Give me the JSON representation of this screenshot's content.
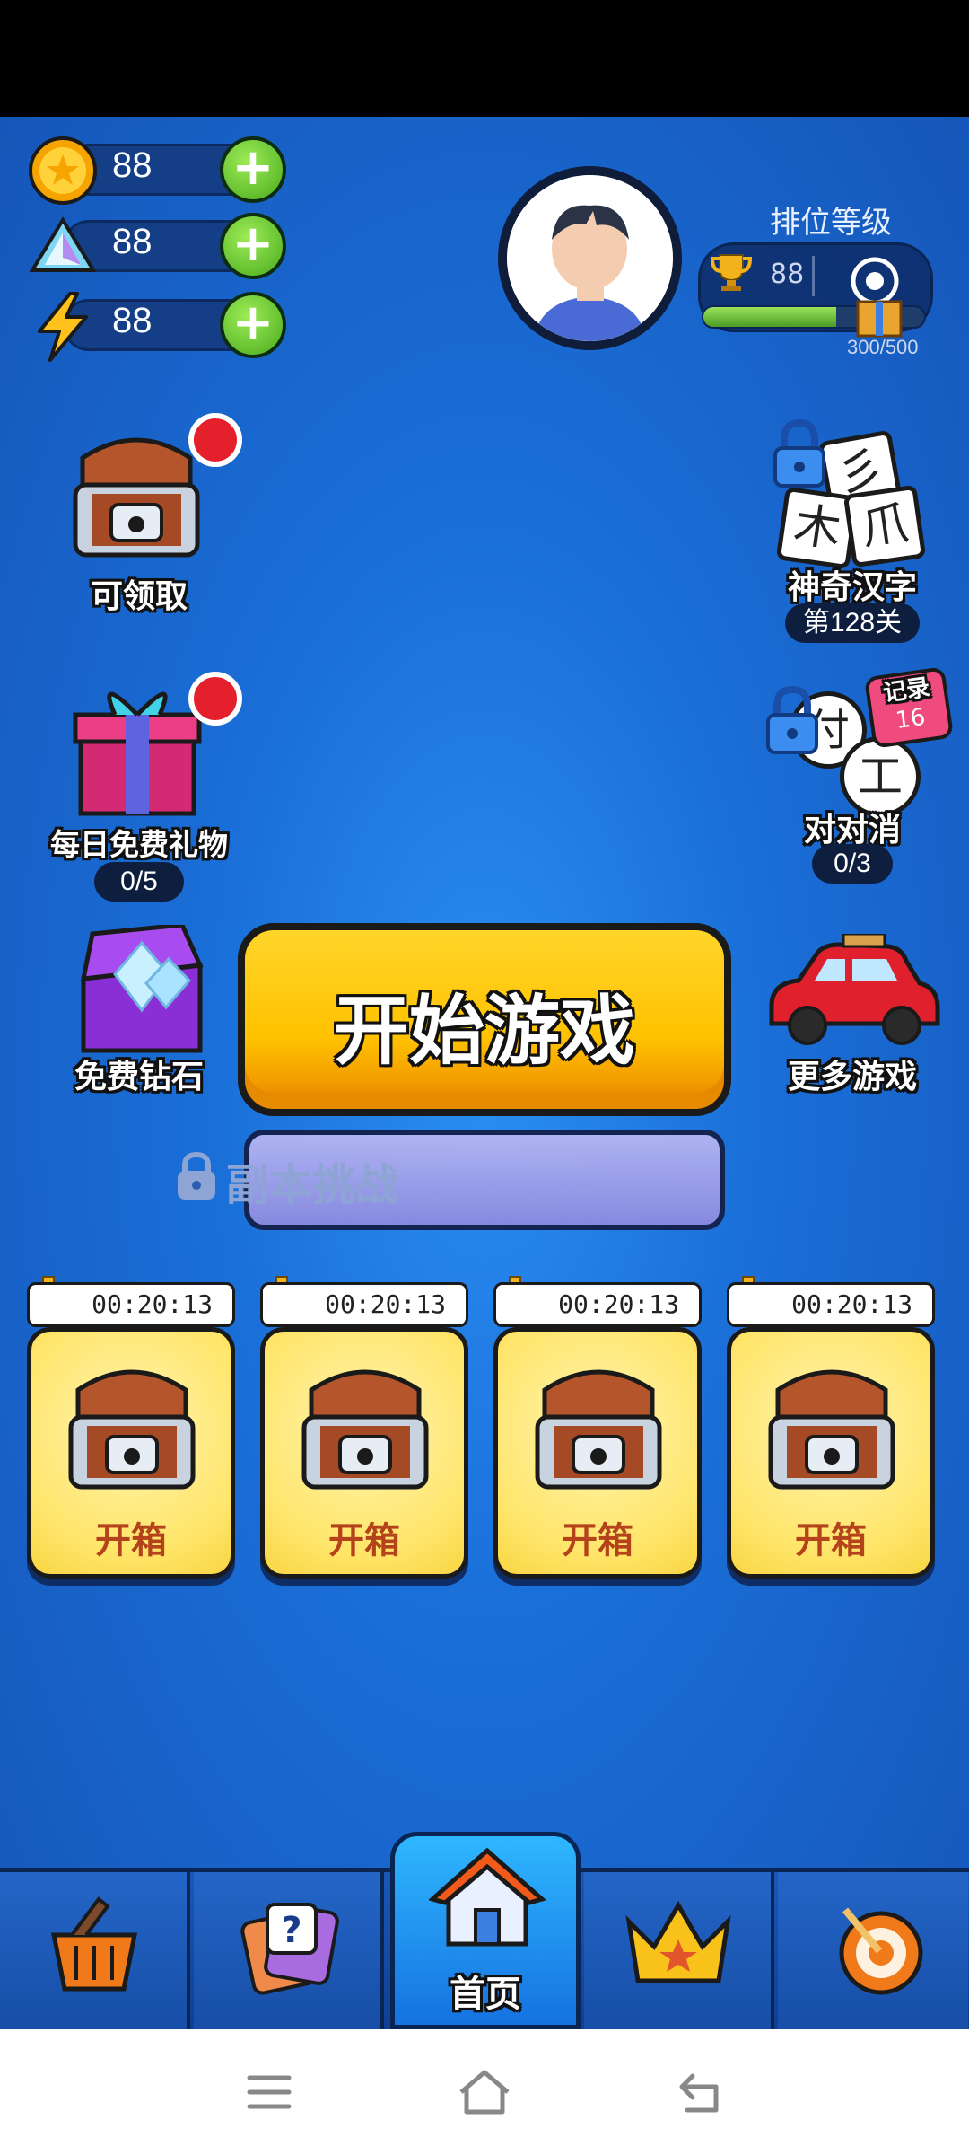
{
  "currencies": [
    {
      "name": "coin-icon",
      "value": "88"
    },
    {
      "name": "diamond-icon",
      "value": "88"
    },
    {
      "name": "energy-icon",
      "value": "88"
    }
  ],
  "rank": {
    "title": "排位等级",
    "level": "88",
    "progress_text": "300/500",
    "progress_fraction": 0.6
  },
  "left_items": {
    "claimable": {
      "label": "可领取"
    },
    "daily_gift": {
      "label": "每日免费礼物",
      "count": "0/5"
    },
    "free_diamonds": {
      "label": "免费钻石"
    }
  },
  "right_items": {
    "magic_chars": {
      "label": "神奇汉字",
      "level": "第128关",
      "tiles": [
        "彡",
        "木",
        "爪"
      ]
    },
    "match_pairs": {
      "label": "对对消",
      "count": "0/3",
      "record_label": "记录",
      "record_value": "16",
      "tiles": [
        "付",
        "工"
      ]
    },
    "more_games": {
      "label": "更多游戏"
    }
  },
  "start_button": "开始游戏",
  "dungeon_button": "副本挑战",
  "chests": [
    {
      "timer": "00:20:13",
      "label": "开箱"
    },
    {
      "timer": "00:20:13",
      "label": "开箱"
    },
    {
      "timer": "00:20:13",
      "label": "开箱"
    },
    {
      "timer": "00:20:13",
      "label": "开箱"
    }
  ],
  "nav": {
    "home_label": "首页"
  }
}
